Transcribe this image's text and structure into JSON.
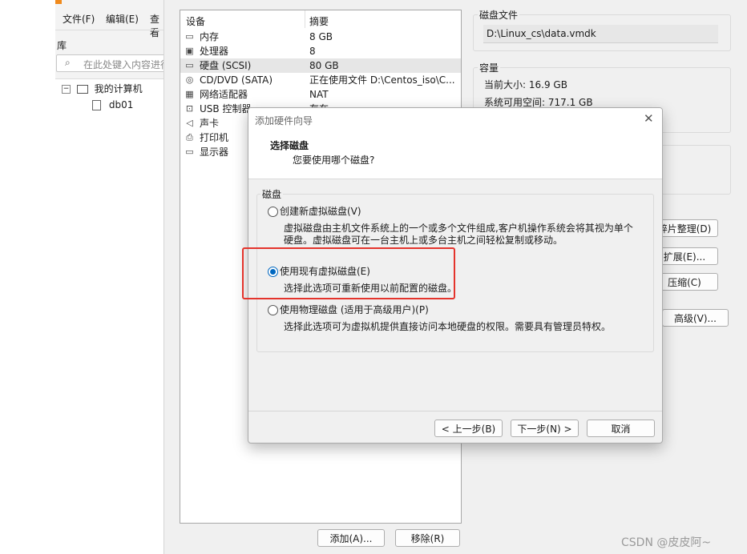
{
  "library": {
    "menu": [
      "文件(F)",
      "编辑(E)",
      "查看"
    ],
    "menu_underline": [
      "F",
      "E",
      ""
    ],
    "title": "库",
    "search_placeholder": "在此处键入内容进行",
    "tree_root": "我的计算机",
    "tree_child": "db01"
  },
  "hardware": {
    "col_device": "设备",
    "col_summary": "摘要",
    "items": [
      {
        "icon": "memory-icon",
        "name": "内存",
        "summary": "8 GB"
      },
      {
        "icon": "processor-icon",
        "name": "处理器",
        "summary": "8"
      },
      {
        "icon": "hard-disk-icon",
        "name": "硬盘 (SCSI)",
        "summary": "80 GB"
      },
      {
        "icon": "cd-dvd-icon",
        "name": "CD/DVD (SATA)",
        "summary": "正在使用文件 D:\\Centos_iso\\C..."
      },
      {
        "icon": "network-adapter-icon",
        "name": "网络适配器",
        "summary": "NAT"
      },
      {
        "icon": "usb-icon",
        "name": "USB 控制器",
        "summary": "存在"
      },
      {
        "icon": "sound-card-icon",
        "name": "声卡",
        "summary": ""
      },
      {
        "icon": "printer-icon",
        "name": "打印机",
        "summary": ""
      },
      {
        "icon": "display-icon",
        "name": "显示器",
        "summary": ""
      }
    ],
    "selected_index": 2,
    "add_button": "添加(A)...",
    "remove_button": "移除(R)"
  },
  "disk_file": {
    "label": "磁盘文件",
    "path": "D:\\Linux_cs\\data.vmdk"
  },
  "capacity": {
    "label": "容量",
    "current_size": "当前大小: 16.9 GB",
    "free_space": "系统可用空间: 717.1 GB"
  },
  "disk_buttons": {
    "defrag": "碎片整理(D)",
    "expand": "扩展(E)...",
    "compact": "压缩(C)",
    "advanced": "高级(V)..."
  },
  "wizard": {
    "title": "添加硬件向导",
    "heading": "选择磁盘",
    "subheading": "您要使用哪个磁盘?",
    "group_label": "磁盘",
    "options": [
      {
        "label": "创建新虚拟磁盘(V)",
        "desc1": "虚拟磁盘由主机文件系统上的一个或多个文件组成,客户机操作系统会将其视为单个",
        "desc2": "硬盘。虚拟磁盘可在一台主机上或多台主机之间轻松复制或移动。",
        "selected": false
      },
      {
        "label": "使用现有虚拟磁盘(E)",
        "desc1": "选择此选项可重新使用以前配置的磁盘。",
        "desc2": "",
        "selected": true
      },
      {
        "label": "使用物理磁盘 (适用于高级用户)(P)",
        "desc1": "选择此选项可为虚拟机提供直接访问本地硬盘的权限。需要具有管理员特权。",
        "desc2": "",
        "selected": false
      }
    ],
    "back_button": "< 上一步(B)",
    "next_button": "下一步(N) >",
    "cancel_button": "取消"
  },
  "watermark": "CSDN @皮皮阿~",
  "colors": {
    "accent": "#0067c0",
    "highlight_box": "#e4342c"
  }
}
